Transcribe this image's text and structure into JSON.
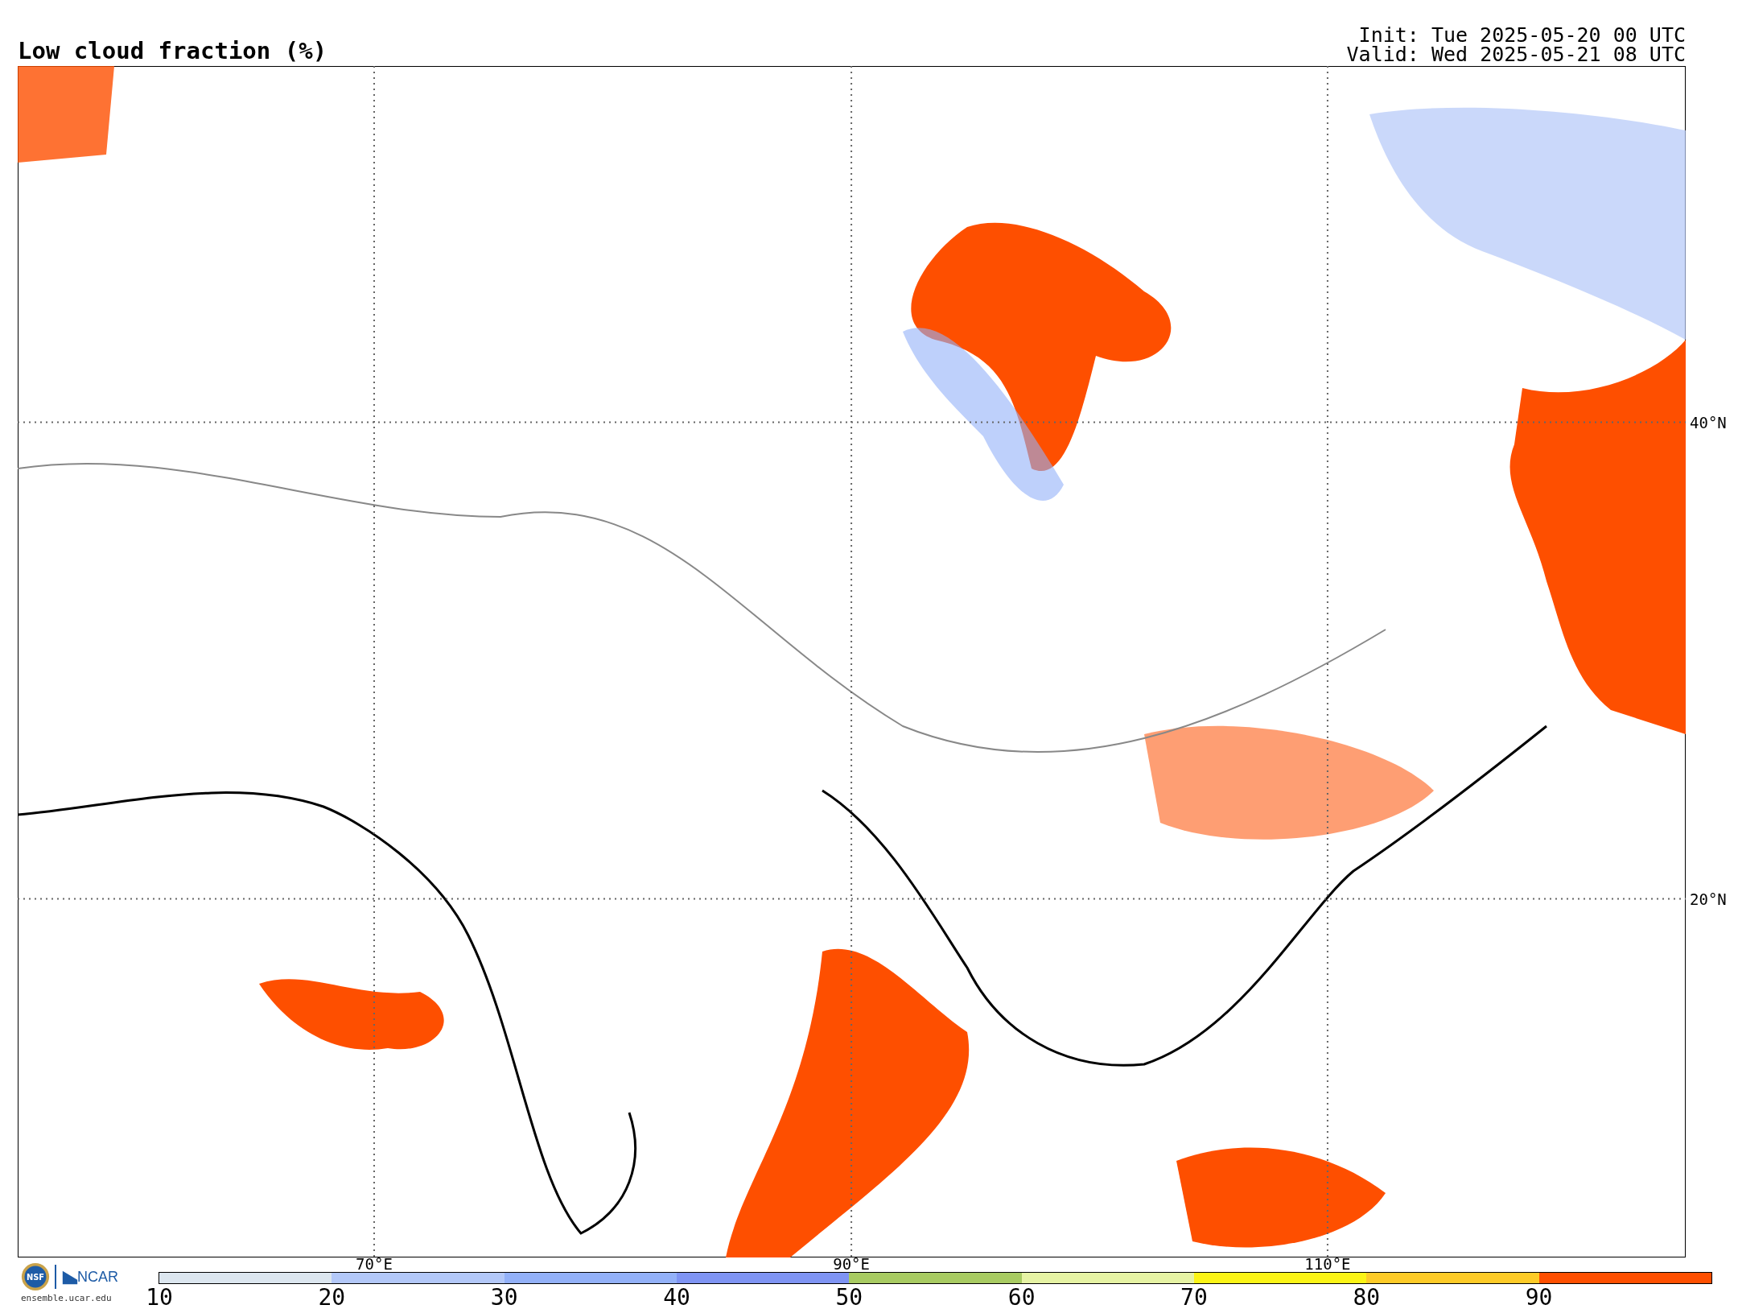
{
  "title": "Low cloud fraction (%)",
  "init": "Init: Tue 2025-05-20 00 UTC",
  "valid": "Valid: Wed 2025-05-21 08 UTC",
  "map": {
    "lat_labels": [
      "40°N",
      "20°N"
    ],
    "lon_labels": [
      "70°E",
      "90°E",
      "110°E"
    ]
  },
  "logos": {
    "nsf": "NSF",
    "ncar": "NCAR",
    "url": "ensemble.ucar.edu"
  },
  "colorbar": {
    "segments": [
      {
        "color": "#dce6ef",
        "tick": "10"
      },
      {
        "color": "#b3c8f8",
        "tick": "20"
      },
      {
        "color": "#93b1f8",
        "tick": "30"
      },
      {
        "color": "#7f94f3",
        "tick": "40"
      },
      {
        "color": "#a8cb62",
        "tick": "50"
      },
      {
        "color": "#e6f3a4",
        "tick": "60"
      },
      {
        "color": "#fbf416",
        "tick": "70"
      },
      {
        "color": "#fdcb28",
        "tick": "80"
      },
      {
        "color": "#fe4f00",
        "tick": "90"
      }
    ]
  }
}
